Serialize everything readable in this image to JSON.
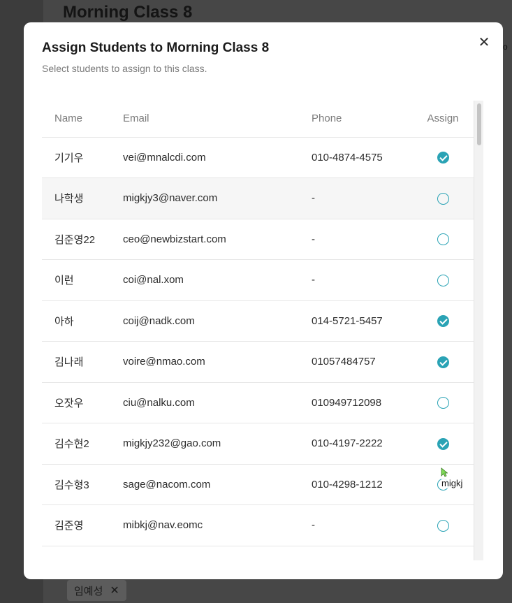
{
  "background": {
    "page_title": "Morning Class 8",
    "edge_text": "o",
    "chip_label": "임예성",
    "chip_remove": "✕"
  },
  "modal": {
    "title": "Assign Students to Morning Class 8",
    "subtitle": "Select students to assign to this class.",
    "close_icon": "✕",
    "columns": {
      "name": "Name",
      "email": "Email",
      "phone": "Phone",
      "assign": "Assign"
    },
    "rows": [
      {
        "name": "기기우",
        "email": "vei@mnalcdi.com",
        "phone": "010-4874-4575",
        "assigned": true
      },
      {
        "name": "나학생",
        "email": "migkjy3@naver.com",
        "phone": "-",
        "assigned": false
      },
      {
        "name": "김준영22",
        "email": "ceo@newbizstart.com",
        "phone": "-",
        "assigned": false
      },
      {
        "name": "이런",
        "email": "coi@nal.xom",
        "phone": "-",
        "assigned": false
      },
      {
        "name": "아하",
        "email": "coij@nadk.com",
        "phone": "014-5721-5457",
        "assigned": true
      },
      {
        "name": "김나래",
        "email": "voire@nmao.com",
        "phone": "01057484757",
        "assigned": true
      },
      {
        "name": "오잣우",
        "email": "ciu@nalku.com",
        "phone": "010949712098",
        "assigned": false
      },
      {
        "name": "김수현2",
        "email": "migkjy232@gao.com",
        "phone": "010-4197-2222",
        "assigned": true
      },
      {
        "name": "김수형3",
        "email": "sage@nacom.com",
        "phone": "010-4298-1212",
        "assigned": false
      },
      {
        "name": "김준영",
        "email": "mibkj@nav.eomc",
        "phone": "-",
        "assigned": false
      }
    ],
    "accent_color": "#2aa3b5"
  },
  "cursor_label": "migkj"
}
